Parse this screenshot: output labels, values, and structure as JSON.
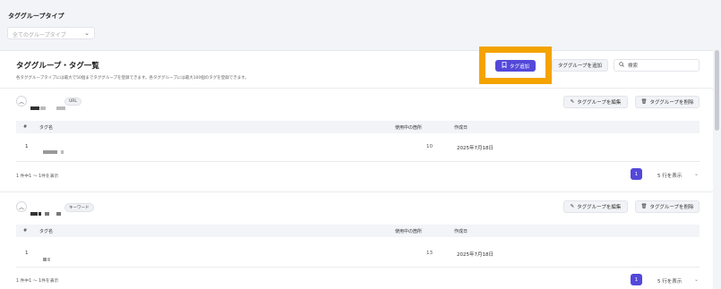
{
  "filter": {
    "label": "タググループタイプ",
    "select_value": "全てのグループタイプ",
    "chevron": "⌄"
  },
  "header": {
    "title": "タググループ・タグ一覧",
    "description": "各タググループタイプには最大で50個までタググループを登録できます。各タググループには最大100個のタグを登録できます。",
    "add_tag_label": "タグ追加",
    "add_group_label": "タググループを追加",
    "search_placeholder": "検索",
    "highlight_color": "#f4a300",
    "accent_color": "#5348d9"
  },
  "groups": [
    {
      "chip": "URL",
      "edit_label": "タググループを編集",
      "delete_label": "タググループを削除",
      "columns": [
        "#",
        "タグ名",
        "使用中の箇所",
        "作成日"
      ],
      "rows": [
        {
          "index": "1",
          "usage": "10",
          "created": "2025年7月18日"
        }
      ],
      "summary": "1 件中1 ～ 1件を表示",
      "page": "1",
      "rows_per_page": "5 行を表示"
    },
    {
      "chip": "キーワード",
      "edit_label": "タググループを編集",
      "delete_label": "タググループを削除",
      "columns": [
        "#",
        "タグ名",
        "使用中の箇所",
        "作成日"
      ],
      "rows": [
        {
          "index": "1",
          "usage": "13",
          "created": "2025年7月18日"
        }
      ],
      "summary": "1 件中1 ～ 1件を表示",
      "page": "1",
      "rows_per_page": "5 行を表示"
    }
  ],
  "icons": {
    "tag": "tag-icon",
    "search": "search-icon",
    "edit": "pencil-icon",
    "delete": "trash-icon",
    "collapse": "chevron-up-icon",
    "chevron_down": "chevron-down-icon"
  }
}
